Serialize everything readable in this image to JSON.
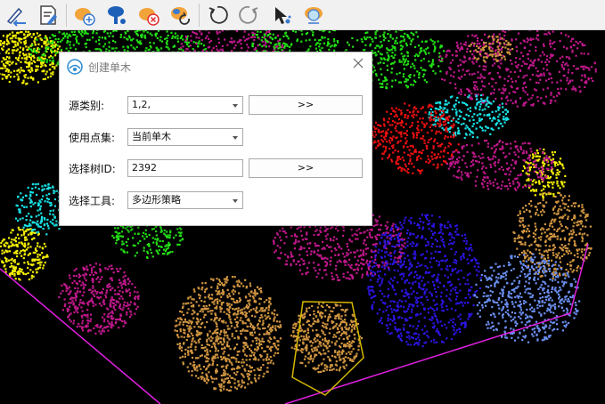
{
  "toolbar": {
    "icons": [
      "edit-undo-icon",
      "document-edit-icon",
      "cloud-add-icon",
      "tree-point-icon",
      "cloud-remove-icon",
      "cloud-refresh-icon",
      "rotate-left-icon",
      "rotate-right-icon",
      "select-arrow-icon",
      "cloud-settings-icon"
    ]
  },
  "dialog": {
    "title": "创建单木",
    "rows": {
      "source_label": "源类别:",
      "source_value": "1,2,",
      "source_button": ">>",
      "pointset_label": "使用点集:",
      "pointset_value": "当前单木",
      "treeid_label": "选择树ID:",
      "treeid_value": "2392",
      "treeid_button": ">>",
      "tool_label": "选择工具:",
      "tool_value": "多边形策略"
    }
  },
  "colors": {
    "magenta": "#c0188c",
    "green": "#22e014",
    "yellow": "#f5f000",
    "cyan": "#18e2e6",
    "red": "#ee1010",
    "orange": "#cf9440",
    "blue": "#2b14e0",
    "lightblue": "#6a8ef0",
    "polygon": "#d4b800",
    "boundary": "#e020e0"
  }
}
